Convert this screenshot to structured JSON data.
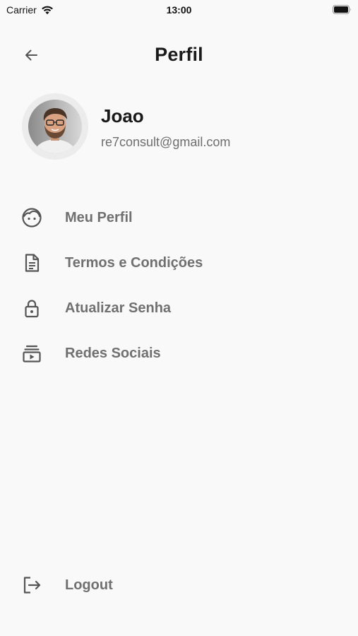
{
  "status_bar": {
    "carrier": "Carrier",
    "time": "13:00",
    "icons": [
      "wifi-icon",
      "battery-icon"
    ]
  },
  "header": {
    "title": "Perfil",
    "back_icon": "arrow-left-icon"
  },
  "profile": {
    "name": "Joao",
    "email": "re7consult@gmail.com",
    "avatar": "avatar-photo"
  },
  "menu": {
    "items": [
      {
        "label": "Meu Perfil",
        "icon": "face-icon"
      },
      {
        "label": "Termos e Condições",
        "icon": "document-icon"
      },
      {
        "label": "Atualizar Senha",
        "icon": "lock-icon"
      },
      {
        "label": "Redes Sociais",
        "icon": "video-library-icon"
      }
    ]
  },
  "logout": {
    "label": "Logout",
    "icon": "logout-icon"
  },
  "colors": {
    "background": "#f9f9f9",
    "text_primary": "#1a1a1a",
    "text_secondary": "#707070",
    "icon": "#555555"
  }
}
